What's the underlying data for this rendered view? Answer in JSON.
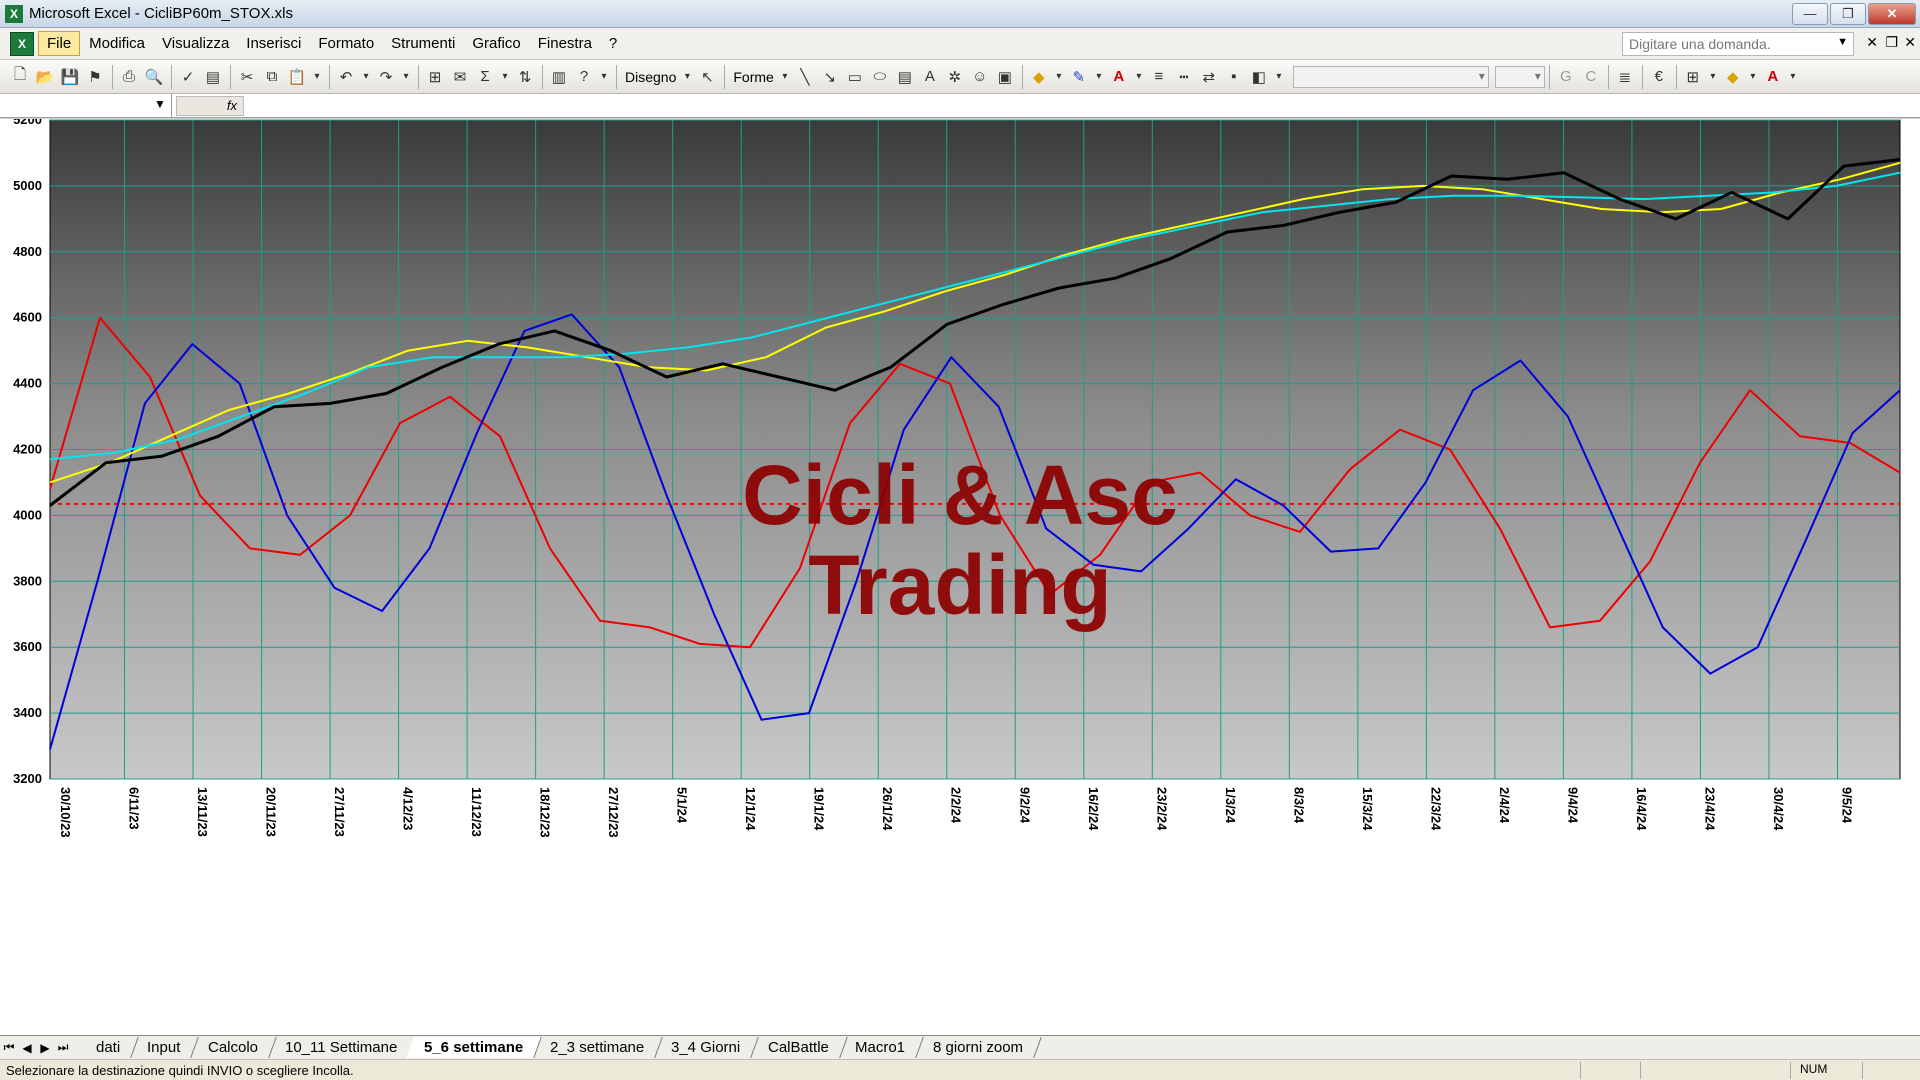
{
  "window": {
    "title": "Microsoft Excel - CicliBP60m_STOX.xls"
  },
  "menu": {
    "items": [
      "File",
      "Modifica",
      "Visualizza",
      "Inserisci",
      "Formato",
      "Strumenti",
      "Grafico",
      "Finestra",
      "?"
    ],
    "active": "File",
    "question_placeholder": "Digitare una domanda."
  },
  "toolbar": {
    "draw_label": "Disegno",
    "shapes_label": "Forme"
  },
  "formula_bar": {
    "fx_label": "fx"
  },
  "chart_data": {
    "type": "line",
    "watermark": [
      "Cicli & Asc",
      "Trading"
    ],
    "ylim": [
      3200,
      5200
    ],
    "yticks": [
      3200,
      3400,
      3600,
      3800,
      4000,
      4200,
      4400,
      4600,
      4800,
      5000,
      5200
    ],
    "x_tick_labels": [
      "30/10/23",
      "6/11/23",
      "13/11/23",
      "20/11/23",
      "27/11/23",
      "4/12/23",
      "11/12/23",
      "18/12/23",
      "27/12/23",
      "5/1/24",
      "12/1/24",
      "19/1/24",
      "26/1/24",
      "2/2/24",
      "9/2/24",
      "16/2/24",
      "23/2/24",
      "1/3/24",
      "8/3/24",
      "15/3/24",
      "22/3/24",
      "2/4/24",
      "9/4/24",
      "16/4/24",
      "23/4/24",
      "30/4/24",
      "9/5/24"
    ],
    "grid": true,
    "series": [
      {
        "color": "#000000",
        "style": "solid-thick",
        "values": [
          4030,
          4160,
          4180,
          4240,
          4330,
          4340,
          4370,
          4450,
          4520,
          4560,
          4500,
          4420,
          4460,
          4420,
          4380,
          4450,
          4580,
          4640,
          4690,
          4720,
          4780,
          4860,
          4880,
          4920,
          4950,
          5030,
          5020,
          5040,
          4960,
          4900,
          4980,
          4900,
          5060,
          5080
        ]
      },
      {
        "color": "#ffff00",
        "style": "solid",
        "values": [
          4100,
          4160,
          4240,
          4320,
          4370,
          4430,
          4500,
          4530,
          4510,
          4480,
          4450,
          4440,
          4480,
          4570,
          4620,
          4680,
          4730,
          4790,
          4840,
          4880,
          4920,
          4960,
          4990,
          5000,
          4990,
          4960,
          4930,
          4920,
          4930,
          4980,
          5020,
          5070
        ]
      },
      {
        "color": "#00e5ee",
        "style": "solid",
        "values": [
          4170,
          4190,
          4230,
          4300,
          4370,
          4450,
          4480,
          4480,
          4480,
          4490,
          4510,
          4540,
          4590,
          4640,
          4690,
          4740,
          4790,
          4840,
          4880,
          4920,
          4940,
          4960,
          4970,
          4970,
          4965,
          4960,
          4970,
          4980,
          5000,
          5040
        ]
      },
      {
        "color": "#ee0000",
        "style": "solid",
        "values": [
          4080,
          4600,
          4420,
          4060,
          3900,
          3880,
          4000,
          4280,
          4360,
          4240,
          3900,
          3680,
          3660,
          3610,
          3600,
          3840,
          4280,
          4460,
          4400,
          4000,
          3760,
          3880,
          4100,
          4130,
          4000,
          3950,
          4140,
          4260,
          4200,
          3960,
          3660,
          3680,
          3860,
          4160,
          4380,
          4240,
          4220,
          4130
        ]
      },
      {
        "color": "#0000dd",
        "style": "solid",
        "values": [
          3290,
          3800,
          4340,
          4520,
          4400,
          4000,
          3780,
          3710,
          3900,
          4250,
          4560,
          4610,
          4450,
          4060,
          3700,
          3380,
          3400,
          3800,
          4260,
          4480,
          4330,
          3960,
          3850,
          3830,
          3960,
          4110,
          4030,
          3890,
          3900,
          4100,
          4380,
          4470,
          4300,
          3980,
          3660,
          3520,
          3600,
          3920,
          4250,
          4380
        ]
      }
    ],
    "reference_line": {
      "color": "#ff0000",
      "style": "dotted",
      "value": 4035
    }
  },
  "sheet_tabs": {
    "items": [
      "dati",
      "Input",
      "Calcolo",
      "10_11 Settimane",
      "5_6 settimane",
      "2_3 settimane",
      "3_4 Giorni",
      "CalBattle",
      "Macro1",
      "8 giorni zoom"
    ],
    "active": "5_6 settimane"
  },
  "status": {
    "message": "Selezionare la destinazione quindi INVIO o scegliere Incolla.",
    "num": "NUM"
  }
}
